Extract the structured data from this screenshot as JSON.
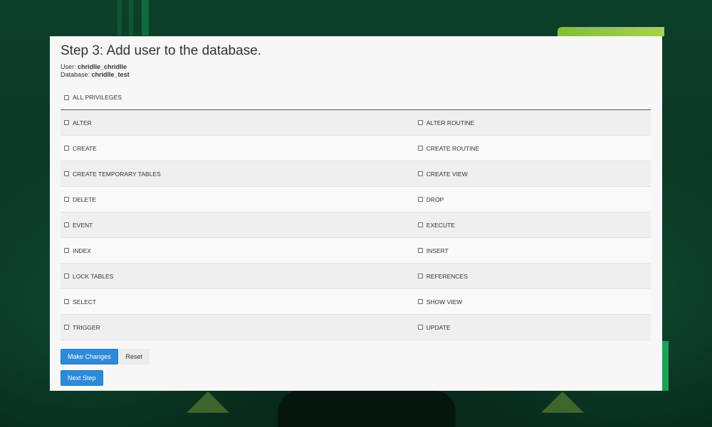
{
  "page": {
    "title": "Step 3: Add user to the database.",
    "user_label": "User:",
    "user_value": "chridlle_chridlle",
    "database_label": "Database:",
    "database_value": "chridlle_test"
  },
  "all_privileges": {
    "label": "ALL PRIVILEGES",
    "checked": false
  },
  "privileges": [
    {
      "left": "ALTER",
      "right": "ALTER ROUTINE"
    },
    {
      "left": "CREATE",
      "right": "CREATE ROUTINE"
    },
    {
      "left": "CREATE TEMPORARY TABLES",
      "right": "CREATE VIEW"
    },
    {
      "left": "DELETE",
      "right": "DROP"
    },
    {
      "left": "EVENT",
      "right": "EXECUTE"
    },
    {
      "left": "INDEX",
      "right": "INSERT"
    },
    {
      "left": "LOCK TABLES",
      "right": "REFERENCES"
    },
    {
      "left": "SELECT",
      "right": "SHOW VIEW"
    },
    {
      "left": "TRIGGER",
      "right": "UPDATE"
    }
  ],
  "buttons": {
    "make_changes": "Make Changes",
    "reset": "Reset",
    "next_step": "Next Step"
  },
  "colors": {
    "primary_button": "#2e8ad8",
    "panel_bg": "#f7f7f7",
    "page_bg": "#0b3a26"
  }
}
